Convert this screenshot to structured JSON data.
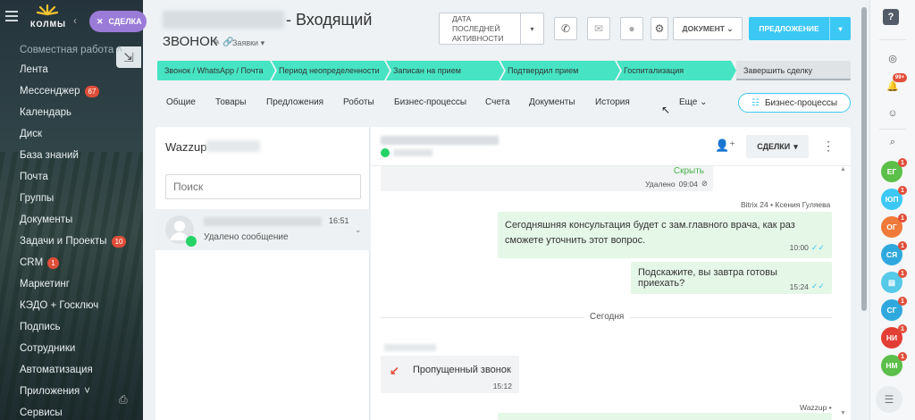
{
  "app": {
    "logo_text": "КОЛМЫ",
    "deal_pill": "СДЕЛКА"
  },
  "sidebar": {
    "group_label": "Совместная работа",
    "items": [
      {
        "label": "Лента",
        "badge": ""
      },
      {
        "label": "Мессенджер",
        "badge": "67"
      },
      {
        "label": "Календарь",
        "badge": ""
      },
      {
        "label": "Диск",
        "badge": ""
      },
      {
        "label": "База знаний",
        "badge": ""
      },
      {
        "label": "Почта",
        "badge": ""
      },
      {
        "label": "Группы",
        "badge": ""
      },
      {
        "label": "Документы",
        "badge": ""
      },
      {
        "label": "Задачи и Проекты",
        "badge": "10"
      },
      {
        "label": "CRM",
        "badge": "1"
      },
      {
        "label": "Маркетинг",
        "badge": ""
      },
      {
        "label": "КЭДО + Госключ",
        "badge": ""
      },
      {
        "label": "Подпись",
        "badge": ""
      },
      {
        "label": "Сотрудники",
        "badge": ""
      },
      {
        "label": "Автоматизация",
        "badge": ""
      },
      {
        "label": "Приложения",
        "badge": ""
      },
      {
        "label": "Сервисы",
        "badge": ""
      }
    ]
  },
  "header": {
    "title": "- Входящий",
    "title_line2": "звонок",
    "pipeline": "Заявки",
    "date_button": "ДАТА ПОСЛЕДНЕЙ АКТИВНОСТИ",
    "document_button": "ДОКУМЕНТ",
    "offer_button": "ПРЕДЛОЖЕНИЕ"
  },
  "stages": [
    "Звонок / WhatsApp / Почта",
    "Период неопределенности",
    "Записан на прием",
    "Подтвердил прием",
    "Госпитализация",
    "Завершить сделку"
  ],
  "tabs": [
    "Общие",
    "Товары",
    "Предложения",
    "Роботы",
    "Бизнес-процессы",
    "Счета",
    "Документы",
    "История",
    "Еще"
  ],
  "bp_button": "Бизнес-процессы",
  "chat_list": {
    "title": "Wazzup",
    "search_placeholder": "Поиск",
    "conversation": {
      "time": "16:51",
      "last_message": "Удалено сообщение"
    }
  },
  "chat": {
    "deals_button": "СДЕЛКИ",
    "messages": {
      "m1": {
        "hide_label": "Скрыть",
        "status": "Удалено",
        "time": "09:04"
      },
      "author1": "Bitrix 24 • Ксения Гуляева",
      "m2": {
        "text": "Сегодняшняя консультация будет с зам.главного врача, как раз сможете уточнить этот вопрос.",
        "time": "10:00"
      },
      "m3": {
        "text": "Подскажите, вы завтра готовы приехать?",
        "time": "15:24"
      },
      "day_separator": "Сегодня",
      "m4": {
        "text": "Пропущенный звонок",
        "time": "15:12"
      },
      "author3": "Wazzup •"
    }
  },
  "rightbar": {
    "help": "?",
    "notif_badge": "99+",
    "avatars": [
      {
        "initials": "ЕГ",
        "color": "#5cbf4a",
        "badge": "1"
      },
      {
        "initials": "ЮП",
        "color": "#3bc8f5",
        "badge": "1"
      },
      {
        "initials": "ОГ",
        "color": "#ef7a3a",
        "badge": "1"
      },
      {
        "initials": "СЯ",
        "color": "#2fa9dd",
        "badge": "1"
      },
      {
        "initials": "",
        "color": "#55c9e8",
        "badge": "1"
      },
      {
        "initials": "СГ",
        "color": "#2fa9dd",
        "badge": "1"
      },
      {
        "initials": "НИ",
        "color": "#e23e35",
        "badge": "1"
      },
      {
        "initials": "НМ",
        "color": "#5cbf4a",
        "badge": "1"
      }
    ]
  },
  "colors": {
    "stage_active": "#46e4c3",
    "accent": "#3bc8f5",
    "badge_red": "#e04e39",
    "whatsapp_green": "#25d366"
  }
}
